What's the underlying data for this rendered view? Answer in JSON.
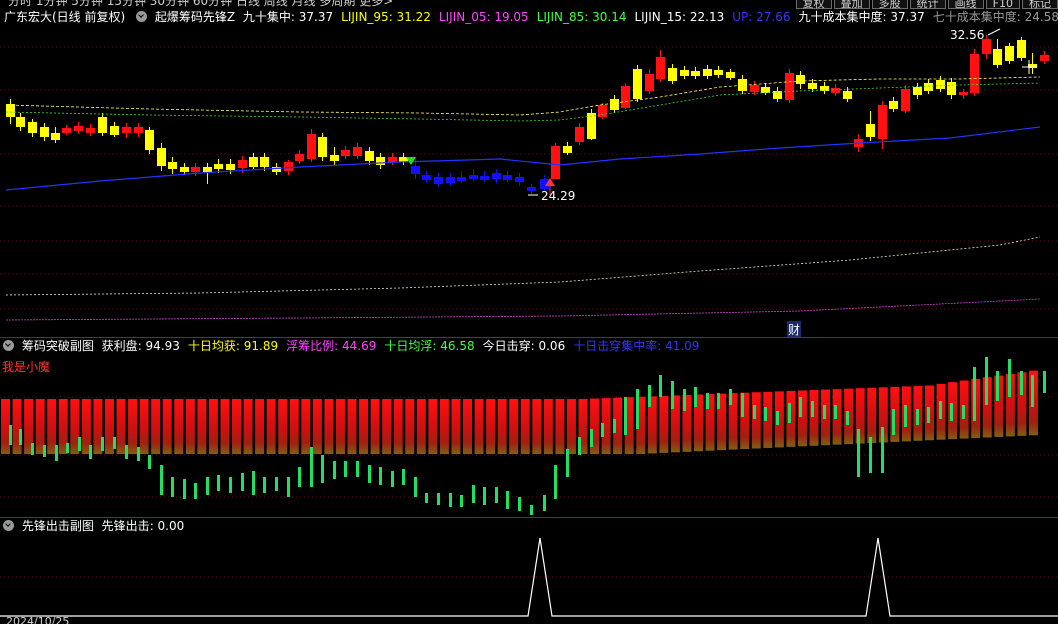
{
  "toolbar": {
    "periods_text": "分时  1分钟  5分钟  15分钟  30分钟  60分钟  日线  周线  月线  多周期  更多>",
    "buttons": [
      "复权",
      "叠加",
      "多股",
      "统计",
      "画线",
      "F10",
      "标记"
    ]
  },
  "main": {
    "stock_title": "广东宏大(日线 前复权)",
    "indicator_name": "起爆筹码先锋Z",
    "items": [
      {
        "label": "九十集中",
        "value": "37.37",
        "color": "#ffffff"
      },
      {
        "label": "LIJIN_95",
        "value": "31.22",
        "color": "#ffff00"
      },
      {
        "label": "LIJIN_05",
        "value": "19.05",
        "color": "#ff44ff"
      },
      {
        "label": "LIJIN_85",
        "value": "30.14",
        "color": "#44ff44"
      },
      {
        "label": "LIJIN_15",
        "value": "22.13",
        "color": "#ffffff"
      },
      {
        "label": "UP",
        "value": "27.66",
        "color": "#3333ff"
      },
      {
        "label": "九十成本集中度",
        "value": "37.37",
        "color": "#ffffff"
      },
      {
        "label": "七十成本集中度",
        "value": "24.58",
        "color": "#9a9a9a"
      }
    ],
    "high_label": "32.56",
    "low_label": "24.29",
    "cai_label": "财",
    "colors": {
      "up": "#ff1111",
      "down": "#ffff00",
      "blue_candle": "#1111ff",
      "ma": "#2233ff"
    }
  },
  "sub1": {
    "title": "筹码突破副图",
    "items": [
      {
        "label": "获利盘",
        "value": "94.93",
        "color": "#ffffff"
      },
      {
        "label": "十日均获",
        "value": "91.89",
        "color": "#ffff00"
      },
      {
        "label": "浮筹比例",
        "value": "44.69",
        "color": "#ff44ff"
      },
      {
        "label": "十日均浮",
        "value": "46.58",
        "color": "#44ff44"
      },
      {
        "label": "今日击穿",
        "value": "0.06",
        "color": "#ffffff"
      },
      {
        "label": "十日击穿集中率",
        "value": "41.09",
        "color": "#3333ff"
      }
    ],
    "note": "我是小魔"
  },
  "sub2": {
    "title": "先锋出击副图",
    "items": [
      {
        "label": "先锋出击",
        "value": "0.00",
        "color": "#ffffff"
      }
    ],
    "date_label": "2024/10/25"
  }
}
